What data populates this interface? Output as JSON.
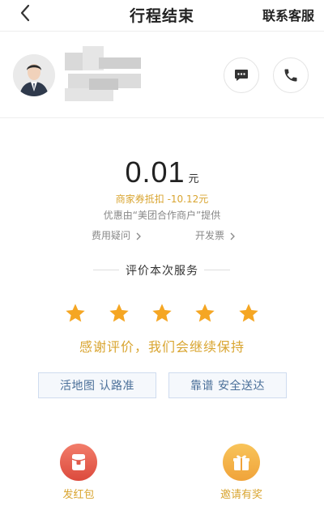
{
  "header": {
    "title": "行程结束",
    "contact_label": "联系客服"
  },
  "driver": {
    "avatar_icon": "driver-avatar-icon",
    "message_icon": "chat-bubble-icon",
    "phone_icon": "phone-icon"
  },
  "fare": {
    "amount": "0.01",
    "unit": "元",
    "discount": "商家券抵扣 -10.12元",
    "promo": "优惠由“美团合作商户”提供",
    "fee_question": "费用疑问",
    "invoice": "开发票"
  },
  "rating": {
    "title": "评价本次服务",
    "stars": 5,
    "max_stars": 5,
    "thanks": "感谢评价，我们会继续保持",
    "tags": [
      "活地图 认路准",
      "靠谱 安全送达"
    ]
  },
  "actions": {
    "red_packet_label": "发红包",
    "invite_label": "邀请有奖"
  },
  "colors": {
    "accent_gold": "#d9a531",
    "star": "#f5a623",
    "tag_text": "#4a6f99",
    "red_packet": "#e05a4b",
    "invite": "#f4b04a"
  }
}
